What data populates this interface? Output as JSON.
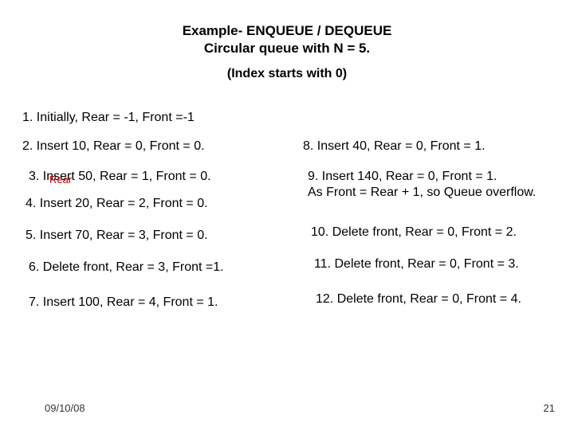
{
  "title_line1": "Example- ENQUEUE / DEQUEUE",
  "title_line2": "Circular queue with N = 5.",
  "subtitle": "(Index starts with 0)",
  "left_items": [
    "1. Initially, Rear = -1, Front =-1",
    "2. Insert 10, Rear = 0, Front = 0.",
    "3. Insert 50, Rear = 1, Front = 0.",
    "4. Insert 20, Rear = 2, Front = 0.",
    "5. Insert 70, Rear = 3, Front = 0.",
    "6. Delete front, Rear = 3, Front =1.",
    "7. Insert 100, Rear = 4, Front = 1."
  ],
  "right_items": [
    "8. Insert 40, Rear = 0, Front = 1.",
    "9. Insert 140, Rear = 0, Front = 1.\n    As Front = Rear + 1, so Queue overflow.",
    "10. Delete front, Rear = 0, Front = 2.",
    "11. Delete front, Rear = 0, Front = 3.",
    "12. Delete front, Rear = 0, Front = 4."
  ],
  "rear_annotation": "Rear",
  "footer": {
    "date": "09/10/08",
    "page": "21"
  }
}
